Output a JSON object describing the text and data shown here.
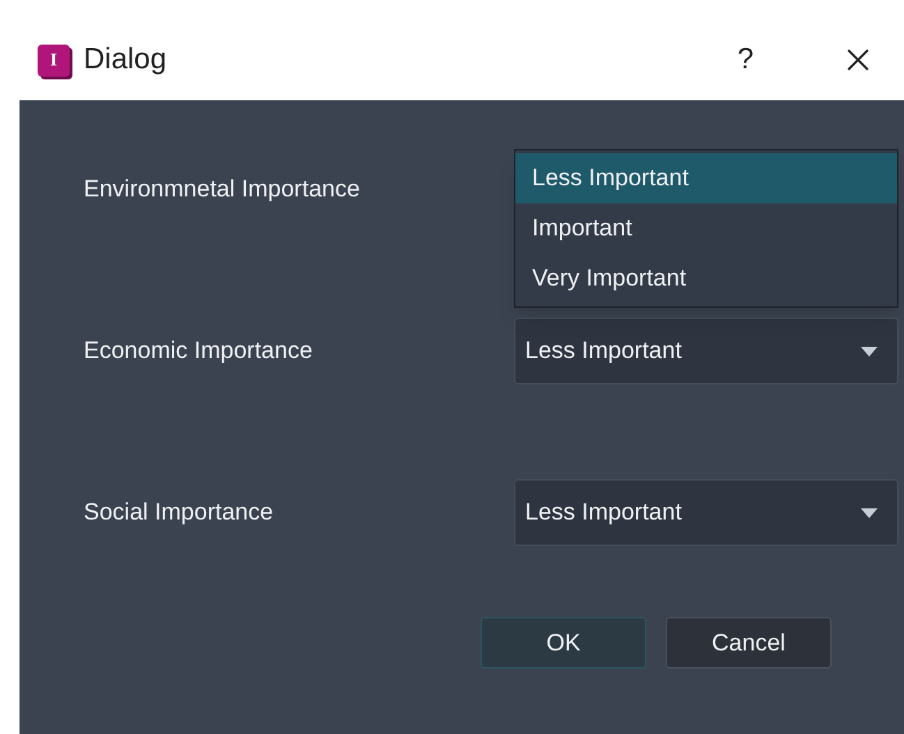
{
  "window": {
    "icon_letter": "I",
    "title": "Dialog",
    "help": "?"
  },
  "rows": [
    {
      "label": "Environmnetal Importance",
      "kind": "open",
      "options": [
        {
          "label": "Less Important",
          "selected": true
        },
        {
          "label": "Important",
          "selected": false
        },
        {
          "label": "Very Important",
          "selected": false
        }
      ]
    },
    {
      "label": "Economic Importance",
      "kind": "closed",
      "value": "Less Important"
    },
    {
      "label": "Social Importance",
      "kind": "closed",
      "value": "Less Important"
    }
  ],
  "buttons": [
    {
      "label": "OK",
      "kind": "default"
    },
    {
      "label": "Cancel",
      "kind": "normal"
    }
  ]
}
